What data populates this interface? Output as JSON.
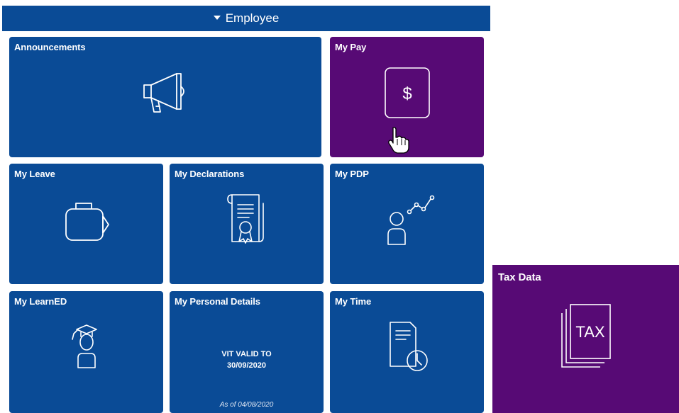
{
  "group": {
    "title": "Employee"
  },
  "tiles": {
    "announcements": {
      "title": "Announcements",
      "icon": "megaphone-icon"
    },
    "my_pay": {
      "title": "My Pay",
      "icon": "dollar-icon"
    },
    "my_leave": {
      "title": "My Leave",
      "icon": "suitcase-icon"
    },
    "my_declarations": {
      "title": "My Declarations",
      "icon": "certificate-icon"
    },
    "my_pdp": {
      "title": "My PDP",
      "icon": "person-growth-icon"
    },
    "my_learned": {
      "title": "My LearnED",
      "icon": "graduate-icon"
    },
    "my_personal_details": {
      "title": "My Personal Details",
      "line1": "VIT VALID TO",
      "line2": "30/09/2020",
      "as_of": "As of 04/08/2020"
    },
    "my_time": {
      "title": "My Time",
      "icon": "timesheet-clock-icon"
    },
    "tax_data": {
      "title": "Tax Data",
      "icon_text": "TAX"
    }
  },
  "colors": {
    "blue": "#0a4b96",
    "purple": "#570a75"
  }
}
